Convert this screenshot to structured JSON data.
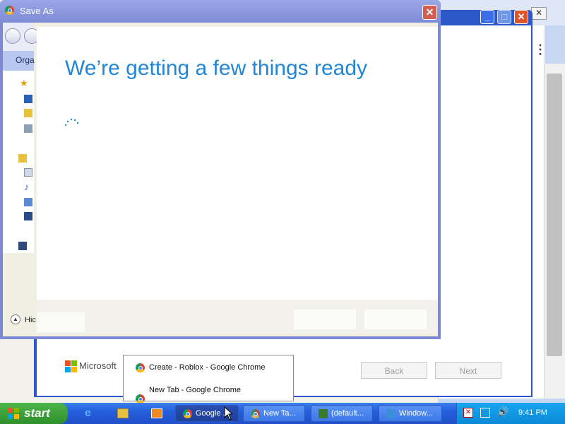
{
  "save_as": {
    "title": "Save As",
    "close_glyph": "✕",
    "organize_label": "Orga",
    "hide_label": "Hic"
  },
  "installer": {
    "headline": "We’re getting a few things ready",
    "brand_text": "Microsoft",
    "back_label": "Back",
    "next_label": "Next"
  },
  "background_window": {
    "tab_close_glyph": "✕",
    "menu_glyph": "⋮"
  },
  "taskbar": {
    "start_label": "start",
    "buttons": [
      {
        "label": "Google ..."
      },
      {
        "label": "New Ta..."
      },
      {
        "label": "(default..."
      },
      {
        "label": "Window..."
      }
    ],
    "clock": "9:41 PM"
  },
  "popup": {
    "items": [
      {
        "label": "Create - Roblox - Google Chrome"
      },
      {
        "label": "New Tab - Google Chrome"
      }
    ]
  },
  "colors": {
    "accent_blue": "#1f86d8",
    "xp_taskbar": "#245edc",
    "xp_start_green": "#3a9b35"
  }
}
